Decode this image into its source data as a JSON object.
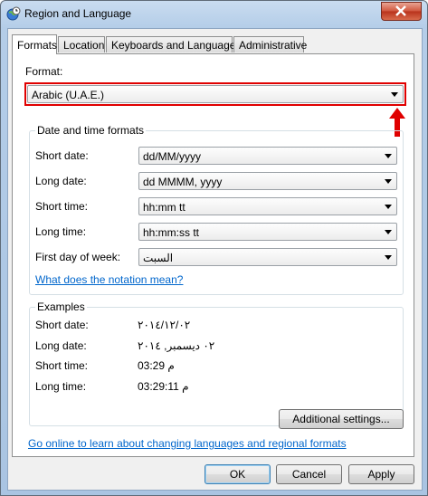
{
  "window": {
    "title": "Region and Language"
  },
  "tabs": [
    {
      "label": "Formats",
      "active": true
    },
    {
      "label": "Location"
    },
    {
      "label": "Keyboards and Languages"
    },
    {
      "label": "Administrative"
    }
  ],
  "format": {
    "label": "Format:",
    "value": "Arabic (U.A.E.)"
  },
  "datetime": {
    "title": "Date and time formats",
    "rows": [
      {
        "label": "Short date:",
        "value": "dd/MM/yyyy"
      },
      {
        "label": "Long date:",
        "value": "dd MMMM, yyyy"
      },
      {
        "label": "Short time:",
        "value": "hh:mm tt"
      },
      {
        "label": "Long time:",
        "value": "hh:mm:ss tt"
      },
      {
        "label": "First day of week:",
        "value": "السبت"
      }
    ],
    "notation_link": "What does the notation mean?"
  },
  "examples": {
    "title": "Examples",
    "rows": [
      {
        "label": "Short date:",
        "value": "٢٠١٤/١٢/٠٢"
      },
      {
        "label": "Long date:",
        "value": "٠٢ ديسمبر, ٢٠١٤"
      },
      {
        "label": "Short time:",
        "value": "03:29 م"
      },
      {
        "label": "Long time:",
        "value": "03:29:11 م"
      }
    ]
  },
  "additional_settings_label": "Additional settings...",
  "online_link": "Go online to learn about changing languages and regional formats",
  "buttons": {
    "ok": "OK",
    "cancel": "Cancel",
    "apply": "Apply"
  },
  "colors": {
    "highlight": "#e00000",
    "link": "#0066cc",
    "accent": "#3c7fb1"
  },
  "icons": {
    "app": "globe-clock-icon",
    "close": "close-icon",
    "dropdown": "chevron-down-icon",
    "annotation": "red-arrow-up-icon"
  }
}
